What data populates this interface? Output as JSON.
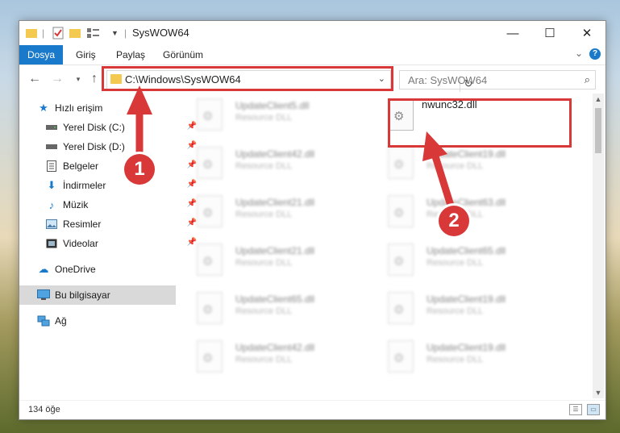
{
  "window": {
    "title": "SysWOW64"
  },
  "ribbon": {
    "tabs": [
      "Dosya",
      "Giriş",
      "Paylaş",
      "Görünüm"
    ],
    "active_tab": "Dosya",
    "help": "?"
  },
  "address": {
    "path": "C:\\Windows\\SysWOW64"
  },
  "search": {
    "placeholder": "Ara: SysWOW64"
  },
  "sidebar": {
    "items": [
      {
        "label": "Hızlı erişim",
        "icon": "star-icon"
      },
      {
        "label": "Yerel Disk (C:)",
        "icon": "drive-icon",
        "pinned": true
      },
      {
        "label": "Yerel Disk (D:)",
        "icon": "drive-icon",
        "pinned": true
      },
      {
        "label": "Belgeler",
        "icon": "document-icon",
        "pinned": true
      },
      {
        "label": "İndirmeler",
        "icon": "download-icon",
        "pinned": true
      },
      {
        "label": "Müzik",
        "icon": "music-icon",
        "pinned": true
      },
      {
        "label": "Resimler",
        "icon": "picture-icon",
        "pinned": true
      },
      {
        "label": "Videolar",
        "icon": "video-icon",
        "pinned": true
      },
      {
        "label": "OneDrive",
        "icon": "cloud-icon"
      },
      {
        "label": "Bu bilgisayar",
        "icon": "computer-icon",
        "selected": true
      },
      {
        "label": "Ağ",
        "icon": "network-icon"
      }
    ]
  },
  "files": {
    "left": [
      {
        "name": "UpdateClient5.dll",
        "desc": "Resource DLL"
      },
      {
        "name": "UpdateClient42.dll",
        "desc": "Resource DLL"
      },
      {
        "name": "UpdateClient21.dll",
        "desc": "Resource DLL"
      },
      {
        "name": "UpdateClient21.dll",
        "desc": "Resource DLL"
      },
      {
        "name": "UpdateClient65.dll",
        "desc": "Resource DLL"
      },
      {
        "name": "UpdateClient42.dll",
        "desc": "Resource DLL"
      }
    ],
    "right": [
      {
        "name": "nwunc32.dll",
        "desc": ""
      },
      {
        "name": "UpdateClient19.dll",
        "desc": "Resource DLL"
      },
      {
        "name": "UpdateClient63.dll",
        "desc": "Resource DLL"
      },
      {
        "name": "UpdateClient65.dll",
        "desc": "Resource DLL"
      },
      {
        "name": "UpdateClient19.dll",
        "desc": "Resource DLL"
      },
      {
        "name": "UpdateClient19.dll",
        "desc": "Resource DLL"
      }
    ]
  },
  "status": {
    "count": "134 öğe"
  },
  "annotations": {
    "step1": "1",
    "step2": "2",
    "color": "#d93838"
  }
}
